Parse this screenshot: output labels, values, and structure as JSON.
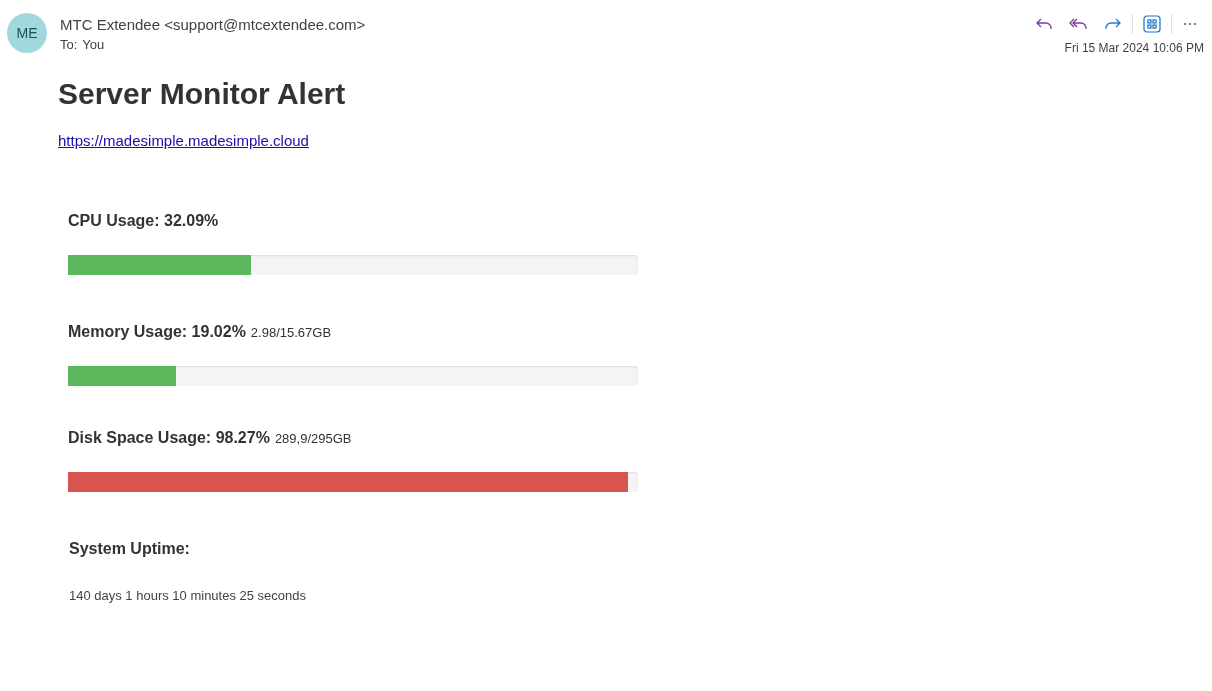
{
  "sender": {
    "initials": "ME",
    "name": "MTC Extendee <support@mtcextendee.com>",
    "to_label": "To:",
    "to": "You"
  },
  "date": "Fri 15 Mar 2024 10:06 PM",
  "body": {
    "title": "Server Monitor Alert",
    "link": "https://madesimple.madesimple.cloud",
    "metrics": [
      {
        "label": "CPU Usage: 32.09%",
        "level": 0.321,
        "color": "#5cb85c"
      },
      {
        "label": "Memory Usage: 19.02%",
        "detail": "2.98/15.67GB",
        "level": 0.19,
        "color": "#5cb85c"
      },
      {
        "label": "Disk Space Usage: 98.27%",
        "detail": "289,9/295GB",
        "level": 0.983,
        "color": "#d9534f"
      }
    ],
    "uptime_label": "System Uptime:",
    "uptime": "140 days 1 hours 10 minutes 25 seconds"
  }
}
